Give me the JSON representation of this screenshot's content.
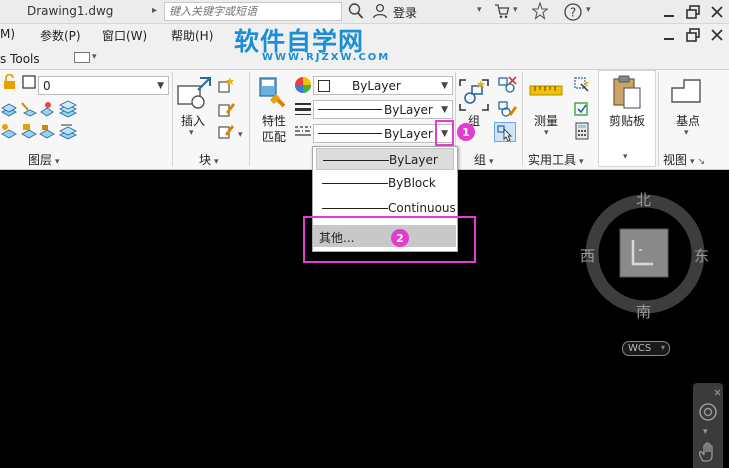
{
  "titlebar": {
    "doc_title": "Drawing1.dwg",
    "search_placeholder": "键入关键字或短语",
    "login_label": "登录"
  },
  "menubar": {
    "items": [
      "M)",
      "参数(P)",
      "窗口(W)",
      "帮助(H)"
    ]
  },
  "watermark": {
    "main": "软件自学网",
    "sub": "WWW.RJZXW.COM"
  },
  "tabrow": {
    "label": "s Tools"
  },
  "ribbon": {
    "layer_combo_value": "0",
    "insert_label": "插入",
    "properties_match_label_1": "特性",
    "properties_match_label_2": "匹配",
    "color_combo_value": "ByLayer",
    "linetype_combo_value": "ByLayer",
    "lineweight_combo_value": "ByLayer",
    "group_label": "组",
    "measure_label": "测量",
    "clipboard_label": "剪贴板",
    "base_label": "基点",
    "panels": {
      "layers": "图层",
      "block": "块",
      "groups": "组",
      "utilities": "实用工具",
      "view": "视图"
    }
  },
  "dropdown": {
    "items": [
      "ByLayer",
      "ByBlock",
      "Continuous"
    ],
    "other": "其他..."
  },
  "annotations": {
    "badge_1": "1",
    "badge_2": "2",
    "highlight_color": "#e43bd1"
  },
  "viewcube": {
    "north": "北",
    "south": "南",
    "west": "西",
    "east": "东",
    "wcs": "WCS"
  }
}
